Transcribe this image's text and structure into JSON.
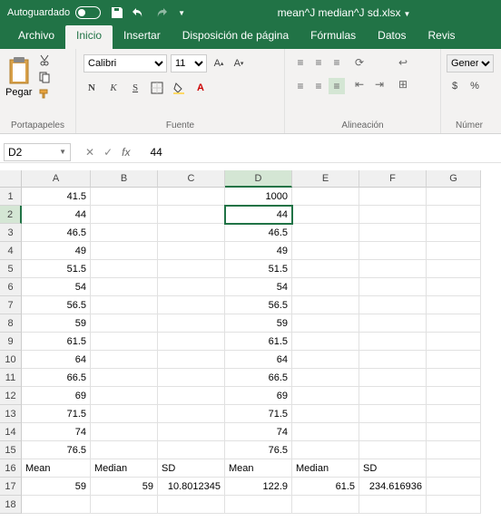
{
  "titlebar": {
    "autosave_label": "Autoguardado",
    "filename": "mean^J median^J sd.xlsx"
  },
  "tabs": {
    "archivo": "Archivo",
    "inicio": "Inicio",
    "insertar": "Insertar",
    "disposicion": "Disposición de página",
    "formulas": "Fórmulas",
    "datos": "Datos",
    "revisar": "Revis"
  },
  "ribbon": {
    "clipboard_label": "Portapapeles",
    "paste_label": "Pegar",
    "font_label": "Fuente",
    "font_name": "Calibri",
    "font_size": "11",
    "align_label": "Alineación",
    "number_label": "Númer",
    "number_format": "General"
  },
  "namebox": "D2",
  "formula_value": "44",
  "columns": [
    "A",
    "B",
    "C",
    "D",
    "E",
    "F",
    "G"
  ],
  "rows": [
    {
      "n": "1",
      "A": "41.5",
      "D": "1000"
    },
    {
      "n": "2",
      "A": "44",
      "D": "44",
      "sel": "D"
    },
    {
      "n": "3",
      "A": "46.5",
      "D": "46.5"
    },
    {
      "n": "4",
      "A": "49",
      "D": "49"
    },
    {
      "n": "5",
      "A": "51.5",
      "D": "51.5"
    },
    {
      "n": "6",
      "A": "54",
      "D": "54"
    },
    {
      "n": "7",
      "A": "56.5",
      "D": "56.5"
    },
    {
      "n": "8",
      "A": "59",
      "D": "59"
    },
    {
      "n": "9",
      "A": "61.5",
      "D": "61.5"
    },
    {
      "n": "10",
      "A": "64",
      "D": "64"
    },
    {
      "n": "11",
      "A": "66.5",
      "D": "66.5"
    },
    {
      "n": "12",
      "A": "69",
      "D": "69"
    },
    {
      "n": "13",
      "A": "71.5",
      "D": "71.5"
    },
    {
      "n": "14",
      "A": "74",
      "D": "74"
    },
    {
      "n": "15",
      "A": "76.5",
      "D": "76.5"
    },
    {
      "n": "16",
      "A": "Mean",
      "B": "Median",
      "C": "SD",
      "D": "Mean",
      "E": "Median",
      "F": "SD",
      "txt": true
    },
    {
      "n": "17",
      "A": "59",
      "B": "59",
      "C": "10.8012345",
      "D": "122.9",
      "E": "61.5",
      "F": "234.616936"
    },
    {
      "n": "18"
    }
  ]
}
